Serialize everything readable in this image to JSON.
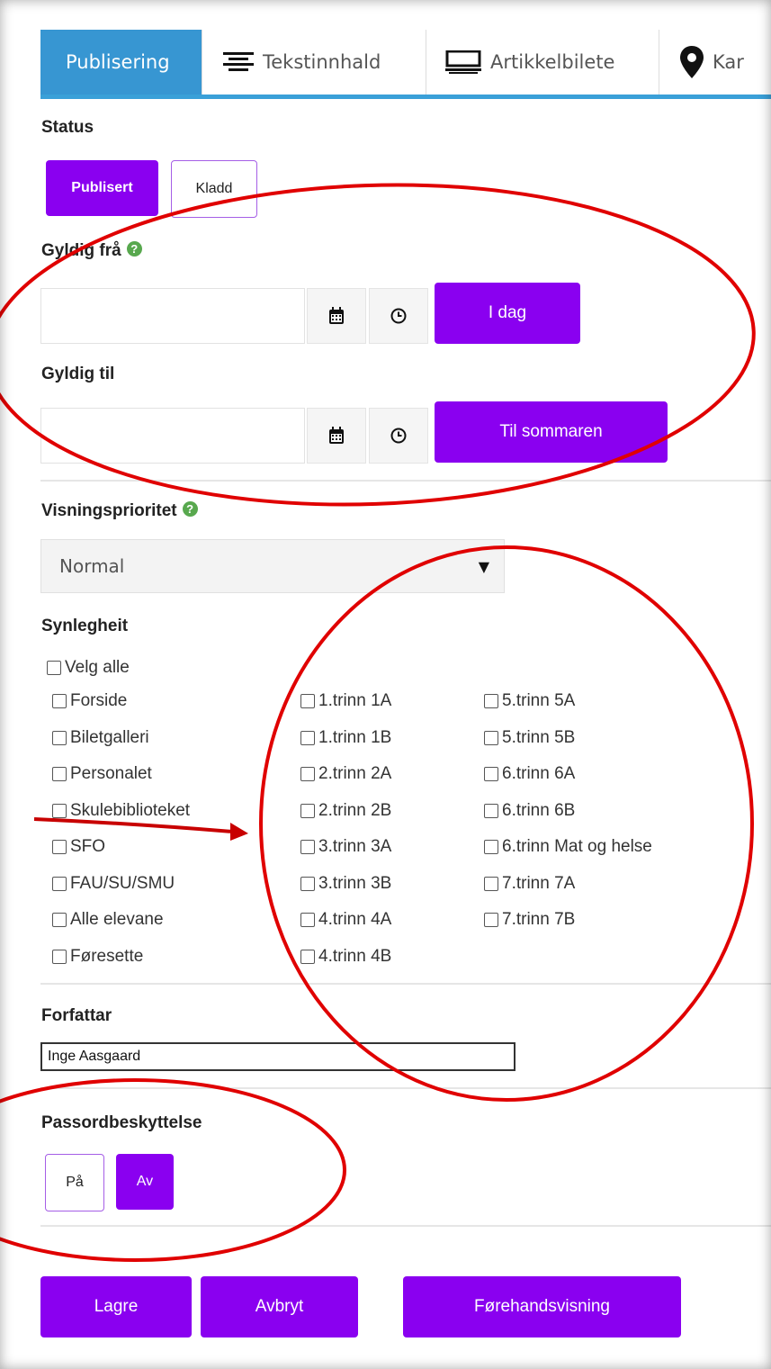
{
  "tabs": [
    {
      "label": "Publisering",
      "icon": "publish-tab",
      "active": true
    },
    {
      "label": "Tekstinnhald",
      "icon": "text-lines-icon",
      "active": false
    },
    {
      "label": "Artikkelbilete",
      "icon": "image-frame-icon",
      "active": false
    },
    {
      "label": "Kar",
      "icon": "map-pin-icon",
      "active": false
    }
  ],
  "status": {
    "heading": "Status",
    "published_label": "Publisert",
    "draft_label": "Kladd"
  },
  "valid_from": {
    "heading": "Gyldig frå",
    "help": "?",
    "value": "",
    "today_label": "I dag"
  },
  "valid_to": {
    "heading": "Gyldig til",
    "value": "",
    "summer_label": "Til sommaren"
  },
  "priority": {
    "heading": "Visningsprioritet",
    "help": "?",
    "selected": "Normal",
    "caret": "▼"
  },
  "visibility": {
    "heading": "Synlegheit",
    "select_all": "Velg alle",
    "col1": [
      "Forside",
      "Biletgalleri",
      "Personalet",
      "Skulebiblioteket",
      "SFO",
      "FAU/SU/SMU",
      "Alle elevane",
      "Føresette"
    ],
    "col2": [
      "1.trinn 1A",
      "1.trinn 1B",
      "2.trinn 2A",
      "2.trinn 2B",
      "3.trinn 3A",
      "3.trinn 3B",
      "4.trinn 4A",
      "4.trinn 4B"
    ],
    "col3": [
      "5.trinn 5A",
      "5.trinn 5B",
      "6.trinn 6A",
      "6.trinn 6B",
      "6.trinn Mat og helse",
      "7.trinn 7A",
      "7.trinn 7B"
    ]
  },
  "author": {
    "heading": "Forfattar",
    "value": "Inge Aasgaard"
  },
  "password": {
    "heading": "Passordbeskyttelse",
    "on_label": "På",
    "off_label": "Av"
  },
  "actions": {
    "save_label": "Lagre",
    "cancel_label": "Avbryt",
    "preview_label": "Førehandsvisning"
  },
  "colors": {
    "accent_purple": "#8a00f0",
    "tab_active_blue": "#3796d2",
    "annotation_red": "#e00000"
  }
}
